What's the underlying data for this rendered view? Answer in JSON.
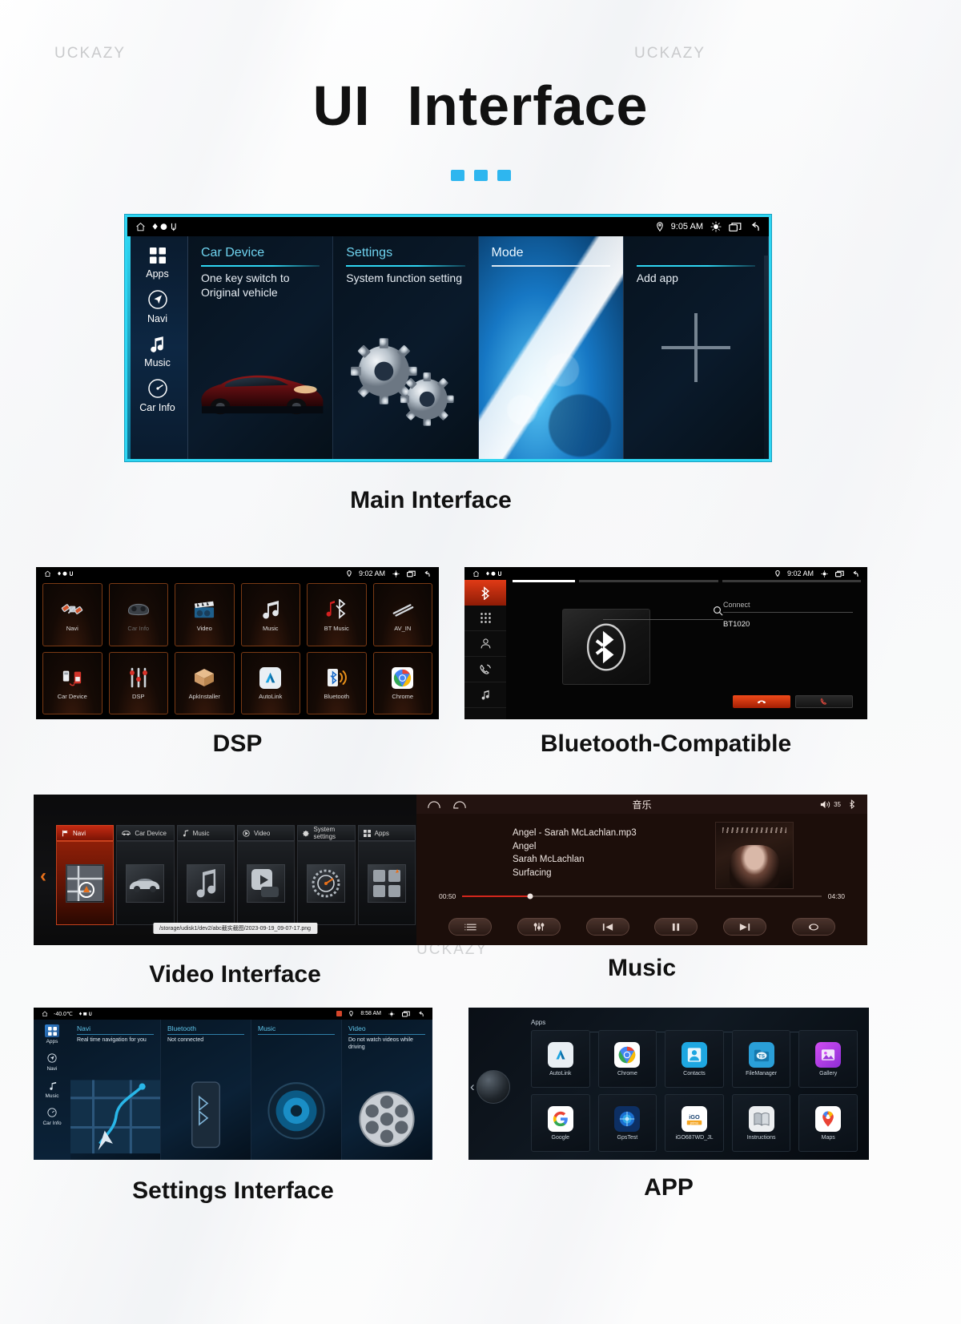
{
  "page": {
    "title_part1": "UI",
    "title_part2": "Interface",
    "watermark_left": "UCKAZY",
    "watermark_right": "UCKAZY",
    "watermark_mid": "UCKAZY",
    "watermark_low": "UCKAZY",
    "watermark_low2": "UCKAZY",
    "watermark_low3": "UCKAZY",
    "accent": "#2eb6ef"
  },
  "captions": {
    "main": "Main Interface",
    "dsp": "DSP",
    "bluetooth": "Bluetooth-Compatible",
    "video": "Video Interface",
    "music": "Music",
    "settings": "Settings Interface",
    "app": "APP"
  },
  "main_interface": {
    "status": {
      "time": "9:05 AM",
      "home_icon": "home-icon",
      "location_icon": "location-pin-icon",
      "brightness_icon": "brightness-icon",
      "windows_icon": "recent-apps-icon",
      "back_icon": "back-icon"
    },
    "sidebar": [
      {
        "label": "Apps",
        "icon": "grid-apps-icon"
      },
      {
        "label": "Navi",
        "icon": "navigation-icon"
      },
      {
        "label": "Music",
        "icon": "music-note-icon"
      },
      {
        "label": "Car Info",
        "icon": "gauge-icon"
      }
    ],
    "cards": [
      {
        "title": "Car Device",
        "subtitle": "One key switch to Original vehicle",
        "art": "car-photo"
      },
      {
        "title": "Settings",
        "subtitle": "System function setting",
        "art": "gears-photo"
      },
      {
        "title": "Mode",
        "subtitle": "",
        "art": "ice-photo"
      },
      {
        "title": "",
        "subtitle": "Add app",
        "art": "plus-icon"
      }
    ]
  },
  "dsp_screen": {
    "status": {
      "time": "9:02 AM"
    },
    "apps": [
      {
        "label": "Navi",
        "icon": "satellite-icon",
        "dim": false
      },
      {
        "label": "Car Info",
        "icon": "car-dashboard-icon",
        "dim": true
      },
      {
        "label": "Video",
        "icon": "clapperboard-icon",
        "dim": false
      },
      {
        "label": "Music",
        "icon": "music-notes-icon",
        "dim": false
      },
      {
        "label": "BT Music",
        "icon": "bluetooth-music-icon",
        "dim": false
      },
      {
        "label": "AV_IN",
        "icon": "av-cable-icon",
        "dim": false
      },
      {
        "label": "Car Device",
        "icon": "usb-transfer-icon",
        "dim": false
      },
      {
        "label": "DSP",
        "icon": "equalizer-icon",
        "dim": false
      },
      {
        "label": "ApkInstaller",
        "icon": "package-box-icon",
        "dim": false
      },
      {
        "label": "AutoLink",
        "icon": "autolink-icon",
        "dim": false
      },
      {
        "label": "Bluetooth",
        "icon": "bluetooth-phone-icon",
        "dim": false
      },
      {
        "label": "Chrome",
        "icon": "chrome-icon",
        "dim": false
      }
    ]
  },
  "bluetooth_screen": {
    "status": {
      "time": "9:02 AM"
    },
    "sidebar": [
      {
        "icon": "bluetooth-icon",
        "active": true
      },
      {
        "icon": "dialpad-icon",
        "active": false
      },
      {
        "icon": "contacts-icon",
        "active": false
      },
      {
        "icon": "call-history-icon",
        "active": false
      },
      {
        "icon": "bt-music-icon",
        "active": false
      }
    ],
    "search_placeholder": "",
    "connect_header": "Connect",
    "device_name": "BT1020",
    "buttons": [
      {
        "name": "end-call-button",
        "style": "red"
      },
      {
        "name": "call-button",
        "style": "dark"
      }
    ]
  },
  "video_screen": {
    "tabs": [
      {
        "label": "Navi",
        "icon": "flag-icon",
        "active": true
      },
      {
        "label": "Car Device",
        "icon": "car-icon",
        "active": false
      },
      {
        "label": "Music",
        "icon": "music-note-icon",
        "active": false
      },
      {
        "label": "Video",
        "icon": "play-circle-icon",
        "active": false
      },
      {
        "label": "System settings",
        "icon": "gear-icon",
        "active": false
      },
      {
        "label": "Apps",
        "icon": "grid-icon",
        "active": false
      }
    ],
    "file_path": "/storage/udisk1/dev2/abc截实截图/2023-09-19_09-07-17.png",
    "prev_arrow": "‹",
    "next_arrow": "›"
  },
  "music_screen": {
    "title": "音乐",
    "volume": "35",
    "home_icon": "home-icon",
    "back_icon": "back-icon",
    "bt_icon": "bluetooth-icon",
    "track_file": "Angel - Sarah McLachlan.mp3",
    "track_title": "Angel",
    "artist": "Sarah McLachlan",
    "album": "Surfacing",
    "time_elapsed": "00:50",
    "time_total": "04:30",
    "progress_percent": 19,
    "controls": [
      {
        "name": "playlist-button",
        "icon": "list-icon"
      },
      {
        "name": "equalizer-button",
        "icon": "equalizer-icon"
      },
      {
        "name": "previous-button",
        "icon": "previous-icon"
      },
      {
        "name": "play-pause-button",
        "icon": "pause-icon"
      },
      {
        "name": "next-button",
        "icon": "next-icon"
      },
      {
        "name": "repeat-button",
        "icon": "repeat-icon"
      }
    ]
  },
  "settings_screen": {
    "status": {
      "temperature": "-40.0℃",
      "time": "8:58 AM"
    },
    "sidebar": [
      {
        "label": "Apps",
        "icon": "grid-apps-icon",
        "active": true
      },
      {
        "label": "Navi",
        "icon": "navigation-icon",
        "active": false
      },
      {
        "label": "Music",
        "icon": "music-note-icon",
        "active": false
      },
      {
        "label": "Car Info",
        "icon": "gauge-icon",
        "active": false
      }
    ],
    "cards": [
      {
        "title": "Navi",
        "subtitle": "Real time navigation for you",
        "art": "map-route"
      },
      {
        "title": "Bluetooth",
        "subtitle": "Not connected",
        "art": "phone"
      },
      {
        "title": "Music",
        "subtitle": "",
        "art": "speaker"
      },
      {
        "title": "Video",
        "subtitle": "Do not watch videos while driving",
        "art": "film-reel"
      }
    ]
  },
  "app_screen": {
    "header": "Apps",
    "apps": [
      {
        "label": "AutoLink",
        "icon": "autolink-icon",
        "color": "#e8eef3"
      },
      {
        "label": "Chrome",
        "icon": "chrome-icon",
        "color": "#ffffff"
      },
      {
        "label": "Contacts",
        "icon": "contacts-icon",
        "color": "#1ea7e1"
      },
      {
        "label": "FileManager",
        "icon": "filemanager-icon",
        "color": "#2a9fd8"
      },
      {
        "label": "Gallery",
        "icon": "gallery-icon",
        "color": "#c63ae0"
      },
      {
        "label": "Google",
        "icon": "google-icon",
        "color": "#ffffff"
      },
      {
        "label": "GpsTest",
        "icon": "gpstest-icon",
        "color": "#1b6fd0"
      },
      {
        "label": "iGO687WD_JL",
        "icon": "igo-icon",
        "color": "#f5a623"
      },
      {
        "label": "Instructions",
        "icon": "instructions-icon",
        "color": "#f2f2f2"
      },
      {
        "label": "Maps",
        "icon": "maps-icon",
        "color": "#ffffff"
      }
    ]
  }
}
